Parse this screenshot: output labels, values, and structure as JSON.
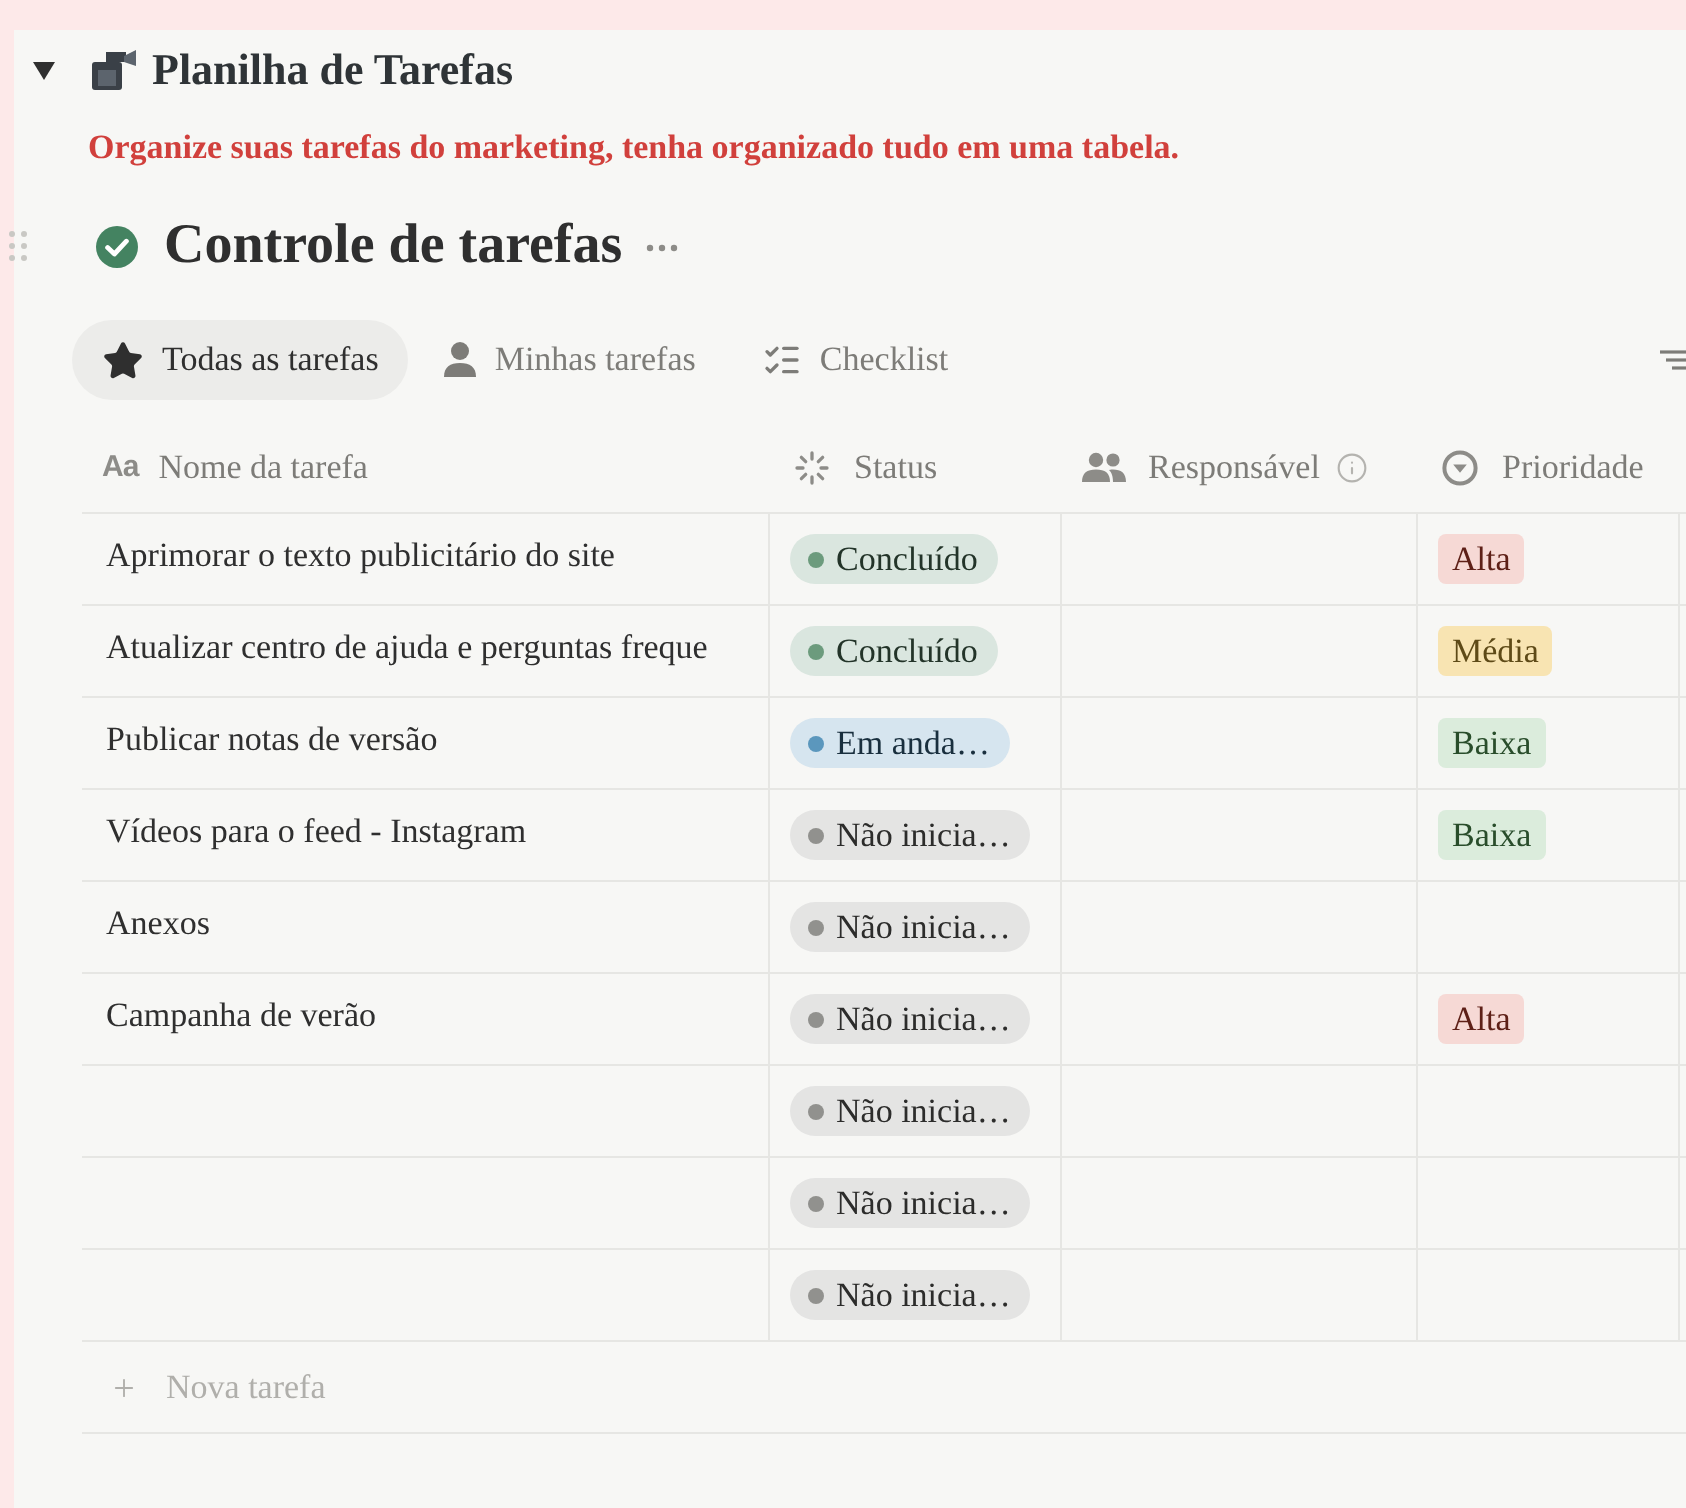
{
  "section": {
    "title": "Planilha de Tarefas",
    "expanded": true,
    "subtitle": "Organize suas tarefas do marketing, tenha organizado tudo em uma tabela."
  },
  "database": {
    "title": "Controle de tarefas"
  },
  "views": [
    {
      "label": "Todas as tarefas",
      "selected": true
    },
    {
      "label": "Minhas tarefas",
      "selected": false
    },
    {
      "label": "Checklist",
      "selected": false
    }
  ],
  "table": {
    "columns": [
      {
        "label": "Nome da tarefa",
        "type_glyph": "Aa"
      },
      {
        "label": "Status"
      },
      {
        "label": "Responsável"
      },
      {
        "label": "Prioridade"
      }
    ],
    "rows": [
      {
        "name": "Aprimorar o texto publicitário do site",
        "status": {
          "label": "Concluído",
          "color": "#6c9b7d"
        },
        "priority": {
          "label": "Alta",
          "color": "#f6d9d5"
        }
      },
      {
        "name": "Atualizar centro de ajuda e perguntas freque",
        "status": {
          "label": "Concluído",
          "color": "#6c9b7d"
        },
        "priority": {
          "label": "Média",
          "color": "#f8e4b2"
        }
      },
      {
        "name": "Publicar notas de versão",
        "status": {
          "label": "Em anda…",
          "color": "#5b97bd"
        },
        "priority": {
          "label": "Baixa",
          "color": "#dbecdc"
        }
      },
      {
        "name": "Vídeos para o feed - Instagram",
        "status": {
          "label": "Não inicia…",
          "color": "#91918e"
        },
        "priority": {
          "label": "Baixa",
          "color": "#dbecdc"
        }
      },
      {
        "name": "Anexos",
        "status": {
          "label": "Não inicia…",
          "color": "#91918e"
        }
      },
      {
        "name": "Campanha de verão",
        "status": {
          "label": "Não inicia…",
          "color": "#91918e"
        },
        "priority": {
          "label": "Alta",
          "color": "#f6d9d5"
        }
      },
      {
        "status": {
          "label": "Não inicia…",
          "color": "#91918e"
        }
      },
      {
        "status": {
          "label": "Não inicia…",
          "color": "#91918e"
        }
      },
      {
        "status": {
          "label": "Não inicia…",
          "color": "#91918e"
        }
      }
    ],
    "new_row": "Nova tarefa"
  }
}
